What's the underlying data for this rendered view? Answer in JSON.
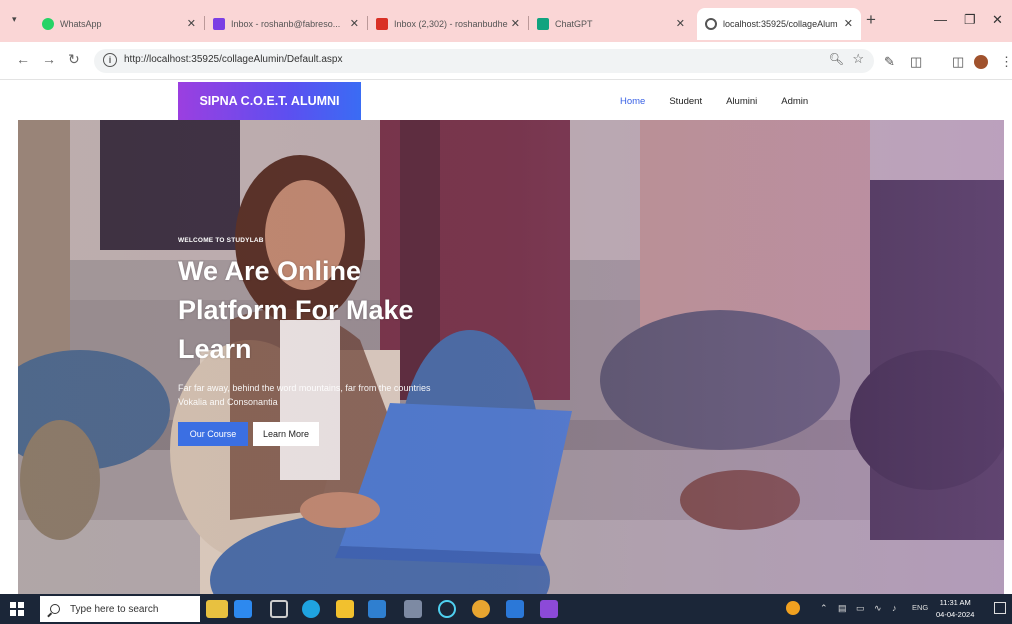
{
  "browser": {
    "tabs": [
      {
        "title": "WhatsApp",
        "color": "#25d366"
      },
      {
        "title": "Inbox - roshanb@fabreso...",
        "color": "#7b3fe4"
      },
      {
        "title": "Inbox (2,302) - roshanbudhe",
        "color": "#d93025"
      },
      {
        "title": "ChatGPT",
        "color": "#10a37f"
      },
      {
        "title": "localhost:35925/collageAlum",
        "color": "#555555"
      }
    ],
    "active_tab_index": 4,
    "url": "http://localhost:35925/collageAlumin/Default.aspx"
  },
  "site": {
    "logo": "SIPNA C.O.E.T. ALUMNI",
    "nav": [
      "Home",
      "Student",
      "Alumini",
      "Admin"
    ],
    "active_nav_index": 0
  },
  "hero": {
    "welcome": "WELCOME TO STUDYLAB",
    "headline": "We Are Online Platform For Make Learn",
    "subtext": "Far far away, behind the word mountains, far from the countries Vokalia and Consonantia",
    "primary_button": "Our Course",
    "secondary_button": "Learn More"
  },
  "taskbar": {
    "search_placeholder": "Type here to search",
    "language": "ENG",
    "time": "11:31 AM",
    "date": "04-04-2024"
  },
  "colors": {
    "accent": "#3b6fe3",
    "logo_gradient_start": "#9b3fe0",
    "logo_gradient_end": "#3a6cf4",
    "tabstrip": "#fad6d6",
    "taskbar": "#1b2638"
  }
}
